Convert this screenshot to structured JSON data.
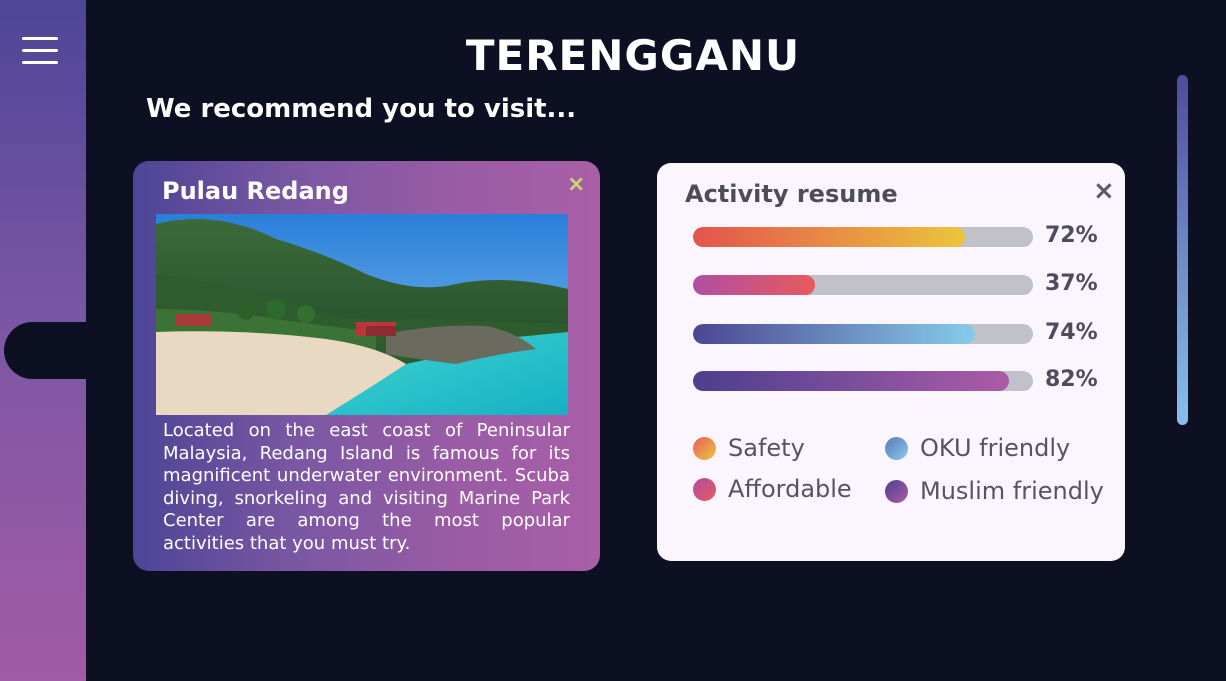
{
  "header": {
    "title": "TERENGGANU",
    "subtitle": "We recommend you to visit..."
  },
  "sidebar": {
    "menu_icon": "hamburger-menu-icon"
  },
  "place_card": {
    "name": "Pulau Redang",
    "close_icon": "close-icon",
    "close_label": "×",
    "image_alt": "Aerial view of Pulau Redang beach with turquoise water and resort",
    "description": "Located on the east coast of Peninsular Malaysia, Redang Island is famous for its magnificent underwater environment. Scuba diving, snorkeling and visiting Marine Park Center are among the most popular activities that you must try."
  },
  "activity_card": {
    "title": "Activity resume",
    "close_label": "×",
    "bars": [
      {
        "label": "72%",
        "value": 0.8,
        "gradient": [
          "#e4534e",
          "#ecc53a"
        ]
      },
      {
        "label": "37%",
        "value": 0.36,
        "gradient": [
          "#b14ea4",
          "#e75a5a"
        ]
      },
      {
        "label": "74%",
        "value": 0.83,
        "gradient": [
          "#4c4692",
          "#86ccea"
        ]
      },
      {
        "label": "82%",
        "value": 0.93,
        "gradient": [
          "#4b3f8e",
          "#ab5ca8"
        ]
      }
    ],
    "legend": [
      {
        "label": "Safety",
        "colors": [
          "#e55d55",
          "#edc544"
        ]
      },
      {
        "label": "OKU friendly",
        "colors": [
          "#5b7ab7",
          "#8cc8ec"
        ]
      },
      {
        "label": "Affordable",
        "colors": [
          "#b14ea4",
          "#e75a5a"
        ]
      },
      {
        "label": "Muslim friendly",
        "colors": [
          "#4b3f8e",
          "#ab5ca8"
        ]
      }
    ]
  },
  "colors": {
    "background": "#0d1022",
    "accent": "#a25ba6",
    "close_accent": "#c6d96a"
  }
}
